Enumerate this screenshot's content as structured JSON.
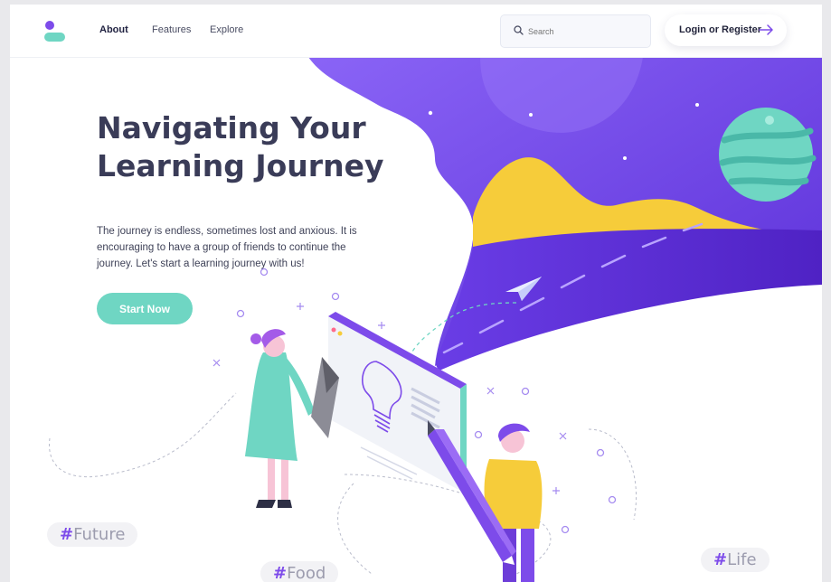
{
  "header": {
    "nav": [
      "About",
      "Features",
      "Explore"
    ],
    "active_nav": "About",
    "search_placeholder": "Search",
    "login_label": "Login or Register"
  },
  "hero": {
    "title": "Navigating Your Learning Journey",
    "description": "The journey is endless, sometimes lost and anxious. It is encouraging to have a group of friends to continue the journey. Let's start a learning journey with us!",
    "cta_label": "Start Now"
  },
  "tags": [
    {
      "hash": "#",
      "text": "Future"
    },
    {
      "hash": "#",
      "text": "Food"
    },
    {
      "hash": "#",
      "text": "Life"
    }
  ],
  "colors": {
    "brand_purple": "#7d4bea",
    "accent_teal": "#6fd6c3",
    "heading": "#3a3c58",
    "sky_purple": "#7b52f0",
    "mountain_yellow": "#f6cc3a"
  },
  "icons": [
    "search-icon",
    "arrow-right-icon",
    "paper-plane-icon",
    "lightbulb-icon",
    "planet-icon",
    "pencil-icon"
  ]
}
